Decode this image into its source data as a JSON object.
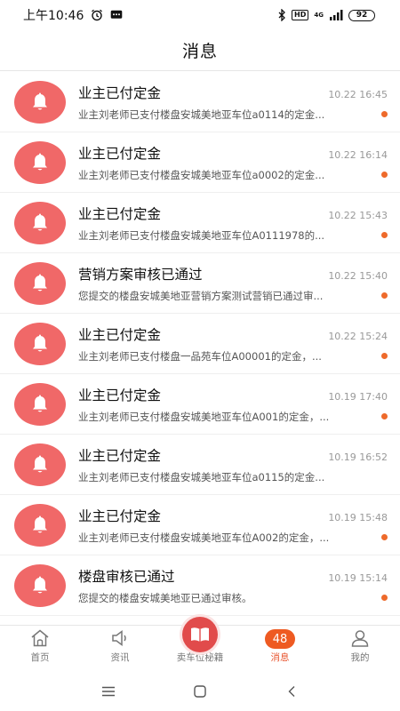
{
  "status_bar": {
    "time": "上午10:46",
    "hd": "HD",
    "network": "4G",
    "battery": "92"
  },
  "header": {
    "title": "消息"
  },
  "messages": [
    {
      "title": "业主已付定金",
      "time": "10.22 16:45",
      "text": "业主刘老师已支付楼盘安城美地亚车位a0114的定金...",
      "unread": true
    },
    {
      "title": "业主已付定金",
      "time": "10.22 16:14",
      "text": "业主刘老师已支付楼盘安城美地亚车位a0002的定金...",
      "unread": true
    },
    {
      "title": "业主已付定金",
      "time": "10.22 15:43",
      "text": "业主刘老师已支付楼盘安城美地亚车位A0111978的...",
      "unread": true
    },
    {
      "title": "营销方案审核已通过",
      "time": "10.22 15:40",
      "text": "您提交的楼盘安城美地亚营销方案测试营销已通过审...",
      "unread": true
    },
    {
      "title": "业主已付定金",
      "time": "10.22 15:24",
      "text": "业主刘老师已支付楼盘一品苑车位A00001的定金，...",
      "unread": true
    },
    {
      "title": "业主已付定金",
      "time": "10.19 17:40",
      "text": "业主刘老师已支付楼盘安城美地亚车位A001的定金，...",
      "unread": true
    },
    {
      "title": "业主已付定金",
      "time": "10.19 16:52",
      "text": "业主刘老师已支付楼盘安城美地亚车位a0115的定金...",
      "unread": false
    },
    {
      "title": "业主已付定金",
      "time": "10.19 15:48",
      "text": "业主刘老师已支付楼盘安城美地亚车位A002的定金，...",
      "unread": true
    },
    {
      "title": "楼盘审核已通过",
      "time": "10.19 15:14",
      "text": "您提交的楼盘安城美地亚已通过审核。",
      "unread": true
    }
  ],
  "tabs": {
    "home": "首页",
    "news": "资讯",
    "center": "卖车位秘籍",
    "messages": "消息",
    "messages_badge": "48",
    "mine": "我的"
  },
  "colors": {
    "accent": "#e8542d",
    "avatar": "#f06868",
    "unread_dot": "#ee6a2b"
  }
}
